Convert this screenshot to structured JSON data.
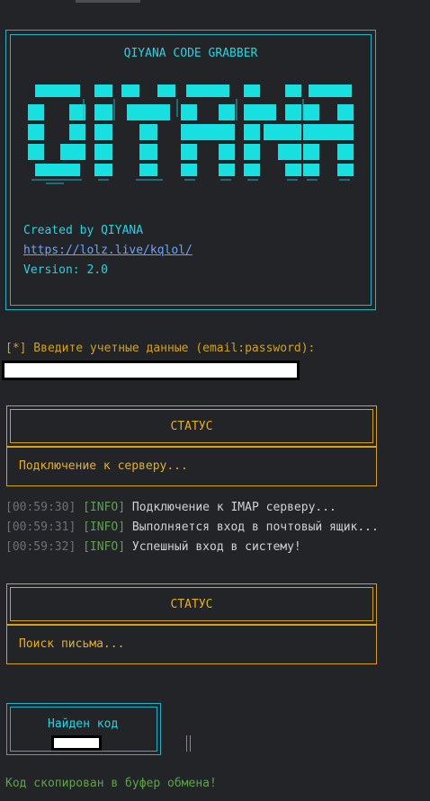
{
  "banner": {
    "title": "QIYANA CODE GRABBER",
    "logo_text": "QIYANA",
    "created_by": "Created by QIYANA",
    "link": "https://lolz.live/kqlol/",
    "version": "Version: 2.0"
  },
  "prompt": {
    "text": "[*] Введите учетные данные (email:password):"
  },
  "status1": {
    "title": "СТАТУС",
    "message": "Подключение к серверу..."
  },
  "logs": [
    {
      "time": "[00:59:30]",
      "level": "[INFO]",
      "message": "Подключение к IMAP серверу..."
    },
    {
      "time": "[00:59:31]",
      "level": "[INFO]",
      "message": "Выполняется вход в почтовый ящик..."
    },
    {
      "time": "[00:59:32]",
      "level": "[INFO]",
      "message": "Успешный вход в систему!"
    }
  ],
  "status2": {
    "title": "СТАТУС",
    "message": "Поиск письма..."
  },
  "found": {
    "title": "Найден код"
  },
  "footer": {
    "copied": "Код скопирован в буфер обмена!"
  },
  "colors": {
    "background": "#222428",
    "cyan": "#27d3e0",
    "amber": "#e4b021",
    "green": "#5da34a",
    "link": "#6aa3ff"
  }
}
